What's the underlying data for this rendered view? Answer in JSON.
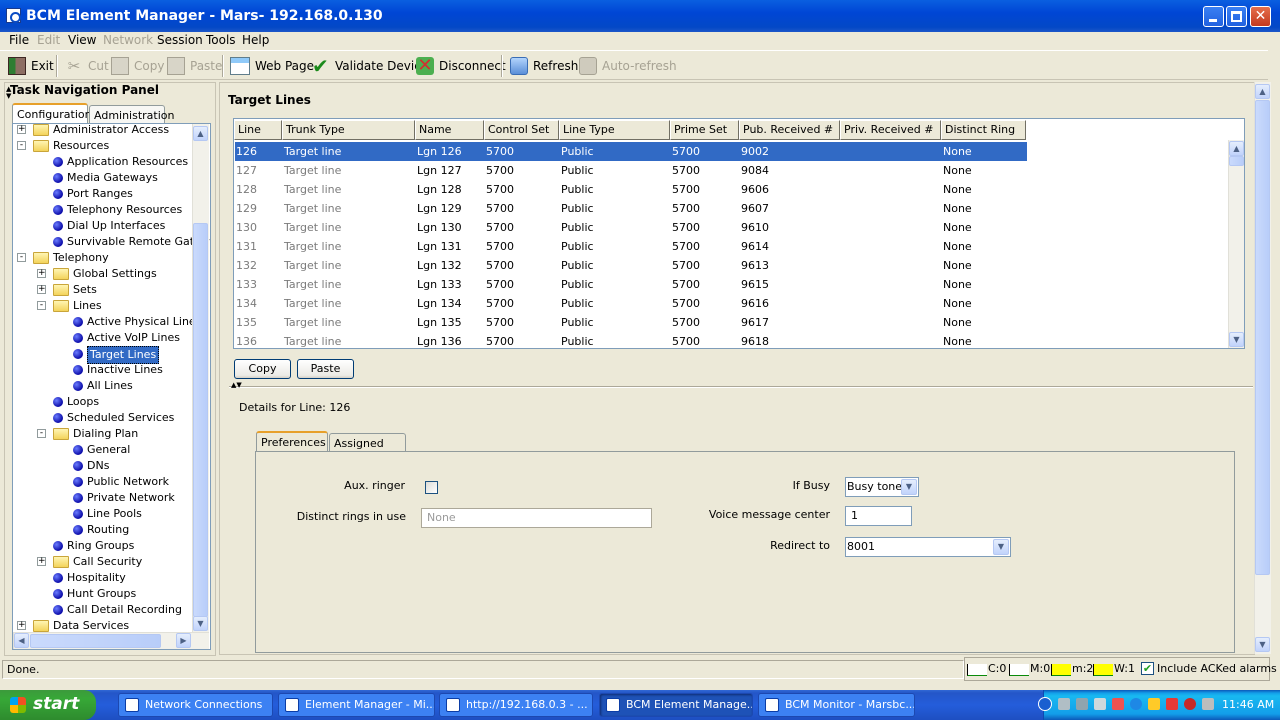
{
  "window": {
    "title": "BCM Element Manager - Mars- 192.168.0.130"
  },
  "menu": [
    "File",
    "Edit",
    "View",
    "Network",
    "Session",
    "Tools",
    "Help"
  ],
  "toolbar": {
    "exit": "Exit",
    "cut": "Cut",
    "copy": "Copy",
    "paste": "Paste",
    "web_page": "Web Page",
    "validate": "Validate Device",
    "disconnect": "Disconnect",
    "refresh": "Refresh",
    "auto_refresh": "Auto-refresh"
  },
  "nav": {
    "title": "Task Navigation Panel",
    "tabs": [
      "Configuration",
      "Administration"
    ],
    "tree": [
      {
        "label": "Administrator Access",
        "level": 0,
        "kind": "folder",
        "exp": "+"
      },
      {
        "label": "Resources",
        "level": 0,
        "kind": "folder-open",
        "exp": "-"
      },
      {
        "label": "Application Resources",
        "level": 1,
        "kind": "leaf"
      },
      {
        "label": "Media Gateways",
        "level": 1,
        "kind": "leaf"
      },
      {
        "label": "Port Ranges",
        "level": 1,
        "kind": "leaf"
      },
      {
        "label": "Telephony Resources",
        "level": 1,
        "kind": "leaf"
      },
      {
        "label": "Dial Up Interfaces",
        "level": 1,
        "kind": "leaf"
      },
      {
        "label": "Survivable Remote Gatew",
        "level": 1,
        "kind": "leaf"
      },
      {
        "label": "Telephony",
        "level": 0,
        "kind": "folder-open",
        "exp": "-"
      },
      {
        "label": "Global Settings",
        "level": 1,
        "kind": "folder",
        "exp": "+"
      },
      {
        "label": "Sets",
        "level": 1,
        "kind": "folder",
        "exp": "+"
      },
      {
        "label": "Lines",
        "level": 1,
        "kind": "folder-open",
        "exp": "-"
      },
      {
        "label": "Active Physical Lines",
        "level": 2,
        "kind": "leaf"
      },
      {
        "label": "Active VoIP Lines",
        "level": 2,
        "kind": "leaf"
      },
      {
        "label": "Target Lines",
        "level": 2,
        "kind": "leaf",
        "selected": true
      },
      {
        "label": "Inactive Lines",
        "level": 2,
        "kind": "leaf"
      },
      {
        "label": "All Lines",
        "level": 2,
        "kind": "leaf"
      },
      {
        "label": "Loops",
        "level": 1,
        "kind": "leaf"
      },
      {
        "label": "Scheduled Services",
        "level": 1,
        "kind": "leaf"
      },
      {
        "label": "Dialing Plan",
        "level": 1,
        "kind": "folder-open",
        "exp": "-"
      },
      {
        "label": "General",
        "level": 2,
        "kind": "leaf"
      },
      {
        "label": "DNs",
        "level": 2,
        "kind": "leaf"
      },
      {
        "label": "Public Network",
        "level": 2,
        "kind": "leaf"
      },
      {
        "label": "Private Network",
        "level": 2,
        "kind": "leaf"
      },
      {
        "label": "Line Pools",
        "level": 2,
        "kind": "leaf"
      },
      {
        "label": "Routing",
        "level": 2,
        "kind": "leaf"
      },
      {
        "label": "Ring Groups",
        "level": 1,
        "kind": "leaf"
      },
      {
        "label": "Call Security",
        "level": 1,
        "kind": "folder",
        "exp": "+"
      },
      {
        "label": "Hospitality",
        "level": 1,
        "kind": "leaf"
      },
      {
        "label": "Hunt Groups",
        "level": 1,
        "kind": "leaf"
      },
      {
        "label": "Call Detail Recording",
        "level": 1,
        "kind": "leaf"
      },
      {
        "label": "Data Services",
        "level": 0,
        "kind": "folder",
        "exp": "+"
      }
    ]
  },
  "main": {
    "title": "Target Lines",
    "columns": [
      "Line",
      "Trunk Type",
      "Name",
      "Control Set",
      "Line Type",
      "Prime Set",
      "Pub. Received #",
      "Priv. Received #",
      "Distinct Ring"
    ],
    "rows": [
      [
        "126",
        "Target line",
        "Lgn 126",
        "5700",
        "Public",
        "5700",
        "9002",
        "",
        "None"
      ],
      [
        "127",
        "Target line",
        "Lgn 127",
        "5700",
        "Public",
        "5700",
        "9084",
        "",
        "None"
      ],
      [
        "128",
        "Target line",
        "Lgn 128",
        "5700",
        "Public",
        "5700",
        "9606",
        "",
        "None"
      ],
      [
        "129",
        "Target line",
        "Lgn 129",
        "5700",
        "Public",
        "5700",
        "9607",
        "",
        "None"
      ],
      [
        "130",
        "Target line",
        "Lgn 130",
        "5700",
        "Public",
        "5700",
        "9610",
        "",
        "None"
      ],
      [
        "131",
        "Target line",
        "Lgn 131",
        "5700",
        "Public",
        "5700",
        "9614",
        "",
        "None"
      ],
      [
        "132",
        "Target line",
        "Lgn 132",
        "5700",
        "Public",
        "5700",
        "9613",
        "",
        "None"
      ],
      [
        "133",
        "Target line",
        "Lgn 133",
        "5700",
        "Public",
        "5700",
        "9615",
        "",
        "None"
      ],
      [
        "134",
        "Target line",
        "Lgn 134",
        "5700",
        "Public",
        "5700",
        "9616",
        "",
        "None"
      ],
      [
        "135",
        "Target line",
        "Lgn 135",
        "5700",
        "Public",
        "5700",
        "9617",
        "",
        "None"
      ],
      [
        "136",
        "Target line",
        "Lgn 136",
        "5700",
        "Public",
        "5700",
        "9618",
        "",
        "None"
      ]
    ],
    "copy_btn": "Copy",
    "paste_btn": "Paste",
    "details_title": "Details for Line: 126",
    "detail_tabs": [
      "Preferences",
      "Assigned DNs"
    ],
    "prefs": {
      "aux_ringer_label": "Aux. ringer",
      "distinct_rings_label": "Distinct rings in use",
      "distinct_rings_value": "None",
      "if_busy_label": "If Busy",
      "if_busy_value": "Busy tone",
      "voice_msg_label": "Voice message center",
      "voice_msg_value": "1",
      "redirect_label": "Redirect to",
      "redirect_value": "8001"
    }
  },
  "status": {
    "text": "Done.",
    "alarms": [
      {
        "label": "C:0",
        "color": "#FFFFFF"
      },
      {
        "label": "M:0",
        "color": "#FFFFFF"
      },
      {
        "label": "m:2",
        "color": "#FFFF00"
      },
      {
        "label": "W:1",
        "color": "#FFFF00"
      }
    ],
    "include_acked": "Include ACKed alarms"
  },
  "taskbar": {
    "start": "start",
    "tasks": [
      "Network Connections",
      "Element Manager - Mi...",
      "http://192.168.0.3 - ...",
      "BCM Element Manage...",
      "BCM Monitor - Marsbc..."
    ],
    "clock": "11:46 AM"
  }
}
